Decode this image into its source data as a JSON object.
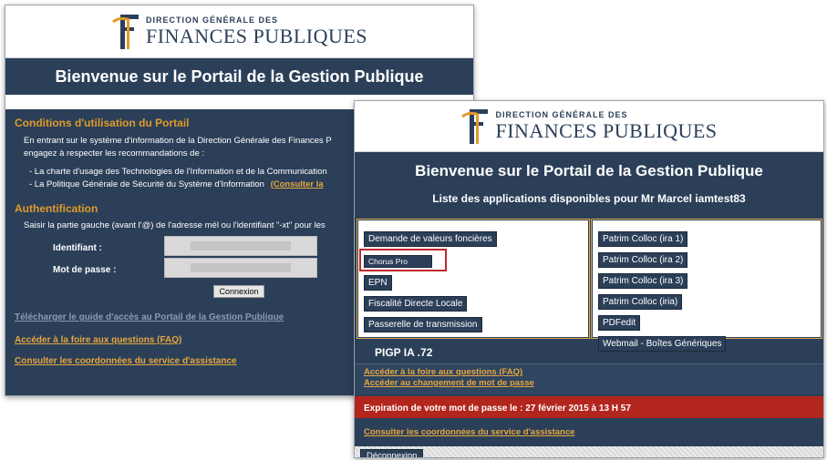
{
  "logo": {
    "line1": "DIRECTION GÉNÉRALE DES",
    "line2": "FINANCES PUBLIQUES"
  },
  "left_window": {
    "title": "Bienvenue sur le Portail de la Gestion Publique",
    "conditions": {
      "heading": "Conditions d'utilisation du Portail",
      "intro_line1": "En entrant sur le système d'information de la Direction Générale des Finances P",
      "intro_line2": "engagez à respecter les recommandations de :",
      "bullet1": "- La charte d'usage des Technologies de l'Information et de la Communication",
      "bullet2": "- La Politique Générale de Sécurité du Système d'Information",
      "bullet2_link": "(Consulter la"
    },
    "auth": {
      "heading": "Authentification",
      "instruction": "Saisir la partie gauche (avant l'@) de l'adresse mél ou l'identifiant \"-xt\" pour les",
      "identifiant_label": "Identifiant :",
      "password_label": "Mot de passe :",
      "connect_button": "Connexion"
    },
    "links": {
      "guide": "Télécharger le guide d'accès au Portail de la Gestion Publique",
      "faq": "Accéder à la foire aux questions (FAQ)",
      "contact": "Consulter les coordonnées du service d'assistance"
    }
  },
  "right_window": {
    "title": "Bienvenue sur le Portail de la Gestion Publique",
    "apps_heading": "Liste des applications disponibles pour Mr Marcel iamtest83",
    "left_apps": [
      "Demande de valeurs foncières",
      "Chorus Pro",
      "EPN",
      "Fiscalité Directe Locale",
      "Passerelle de transmission"
    ],
    "right_apps": [
      "Patrim Colloc (ira 1)",
      "Patrim Colloc (ira 2)",
      "Patrim Colloc (ira 3)",
      "Patrim Colloc (iria)",
      "PDFedit",
      "Webmail - Boîtes Génériques"
    ],
    "version": "PIGP IA .72",
    "links": {
      "faq": "Accéder à la foire aux questions (FAQ)",
      "change_password": "Accéder au changement de mot de passe",
      "contact": "Consulter les coordonnées du service d'assistance"
    },
    "expiration": "Expiration de votre mot de passe le : 27 février 2015 à 13 H 57",
    "logout_button": "Déconnexion"
  },
  "colors": {
    "navy": "#2b3f58",
    "accent_orange": "#e09a2b",
    "expiration_red": "#b3261e",
    "highlight_red": "#c0282d"
  }
}
